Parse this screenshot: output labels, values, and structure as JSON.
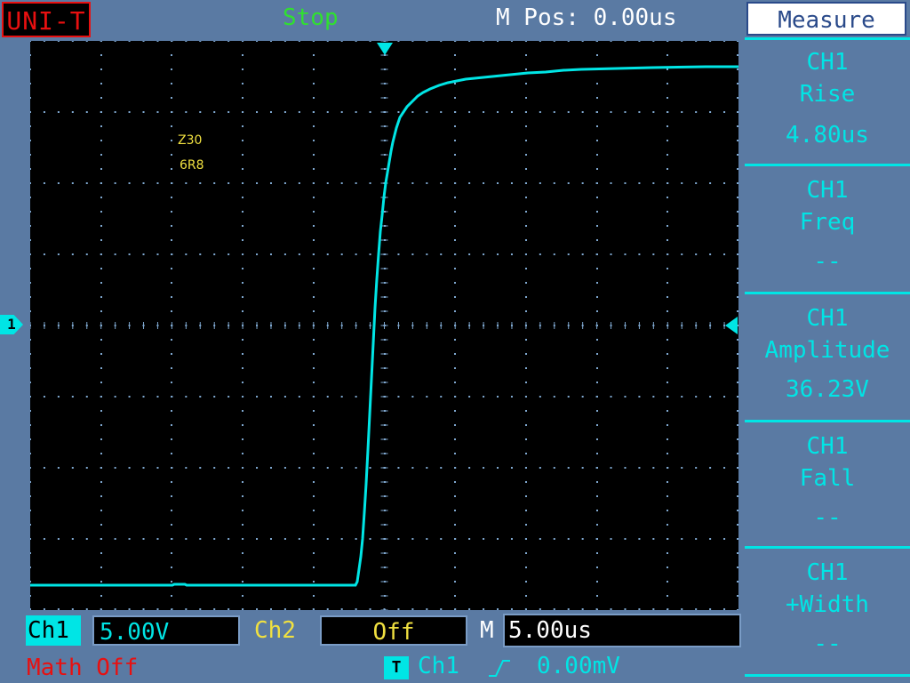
{
  "header": {
    "brand": "UNI-T",
    "run_status": "Stop",
    "position_label": "M Pos: 0.00us"
  },
  "screen": {
    "annotations": [
      "Z30",
      "6R8"
    ],
    "channel_marker": "1",
    "trace_color": "#00e5e5"
  },
  "bottom": {
    "ch1_label": "Ch1",
    "ch1_volts_div": "5.00V",
    "ch2_label": "Ch2",
    "ch2_status": "Off",
    "m_label": "M",
    "timebase": "5.00us",
    "math_status": "Math Off",
    "trigger_icon": "T",
    "trigger_source": "Ch1",
    "trigger_edge_icon": "rising-edge-icon",
    "trigger_level": "0.00mV"
  },
  "menu": {
    "title": "Measure",
    "items": [
      {
        "channel": "CH1",
        "name": "Rise",
        "value": "4.80us"
      },
      {
        "channel": "CH1",
        "name": "Freq",
        "value": "--"
      },
      {
        "channel": "CH1",
        "name": "Amplitude",
        "value": "36.23V"
      },
      {
        "channel": "CH1",
        "name": "Fall",
        "value": "--"
      },
      {
        "channel": "CH1",
        "name": "+Width",
        "value": "--"
      }
    ]
  },
  "colors": {
    "background": "#5a7aa3",
    "ch1": "#00e5e5",
    "ch2": "#f0e040",
    "math": "#e81010",
    "stop": "#30e030"
  }
}
